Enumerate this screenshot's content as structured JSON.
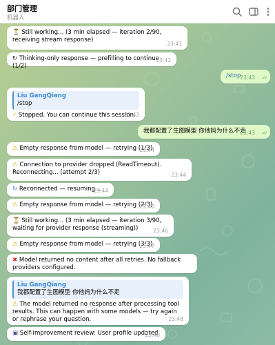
{
  "header": {
    "title": "部门管理",
    "subtitle": "机器人",
    "icons": [
      "search-icon",
      "sidebar-toggle-icon",
      "more-options-icon"
    ]
  },
  "colors": {
    "outgoing_bubble": "#e1f9c8",
    "incoming_bubble": "#ffffff",
    "reply_accent": "#4e8fd1",
    "time_incoming": "#a0a0a0",
    "time_outgoing": "#6da566"
  },
  "messages": [
    {
      "id": 0,
      "dir": "in",
      "icon": "hourglass-icon",
      "glyph": "⏳",
      "text": "Still working... (3 min elapsed — iteration 2/90, receiving stream response)",
      "time": "23:41"
    },
    {
      "id": 1,
      "dir": "in",
      "icon": "refresh-icon",
      "glyph": "↻",
      "text": "Thinking-only response — prefilling to continue (1/2)",
      "time": "23:42"
    },
    {
      "id": 2,
      "dir": "out",
      "text": "/stop",
      "time": "23:43",
      "status": "read"
    },
    {
      "id": 3,
      "dir": "in",
      "reply_name": "Liu GangQiang",
      "reply_text": "/stop",
      "icon": "lightning-icon",
      "glyph": "⚡",
      "text": "Stopped. You can continue this session.",
      "time": "23:43"
    },
    {
      "id": 4,
      "dir": "out",
      "text": "我都配置了生图模型 你他妈为什么不走",
      "time": "23:43",
      "status": "read"
    },
    {
      "id": 5,
      "dir": "in",
      "icon": "warning-icon",
      "glyph": "⚠",
      "text": "Empty response from model — retrying (1/3)",
      "time": "23:44"
    },
    {
      "id": 6,
      "dir": "in",
      "icon": "warning-icon",
      "glyph": "⚠",
      "text": "Connection to provider dropped (ReadTimeout). Reconnecting... (attempt 2/3)",
      "time": "23:44"
    },
    {
      "id": 7,
      "dir": "in",
      "icon": "reconnect-icon",
      "glyph": "↻",
      "text": "Reconnected — resuming...",
      "time": "23:44"
    },
    {
      "id": 8,
      "dir": "in",
      "icon": "warning-icon",
      "glyph": "⚠",
      "text": "Empty response from model — retrying (2/3)",
      "time": "23:46"
    },
    {
      "id": 9,
      "dir": "in",
      "icon": "hourglass-icon",
      "glyph": "⏳",
      "text": "Still working... (3 min elapsed — iteration 3/90, waiting for provider response (streaming))",
      "time": "23:46"
    },
    {
      "id": 10,
      "dir": "in",
      "icon": "warning-icon",
      "glyph": "⚠",
      "text": "Empty response from model — retrying (3/3)",
      "time": "23:47"
    },
    {
      "id": 11,
      "dir": "in",
      "icon": "cross-icon",
      "glyph": "✖",
      "text": "Model returned no content after all retries. No fallback providers configured.",
      "time": ""
    },
    {
      "id": 12,
      "dir": "in",
      "reply_name": "Liu GangQiang",
      "reply_text": "我都配置了生图模型 你他妈为什么不走",
      "icon": "warning-icon",
      "glyph": "⚠",
      "text": "The model returned no response after processing tool results. This can happen with some models — try again or rephrase your question.",
      "time": "23:48"
    },
    {
      "id": 13,
      "dir": "in",
      "icon": "memo-icon",
      "glyph": "▣",
      "text": "Self-improvement review: User profile updated",
      "time": "23:48"
    }
  ]
}
